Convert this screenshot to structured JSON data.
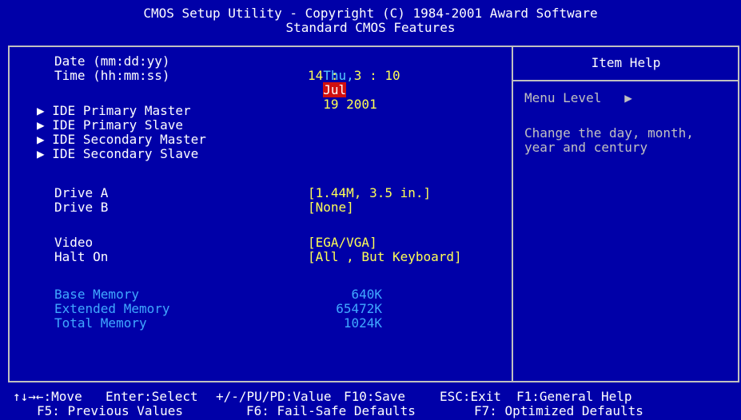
{
  "header": {
    "title": "CMOS Setup Utility - Copyright (C) 1984-2001 Award Software",
    "subtitle": "Standard CMOS Features"
  },
  "date": {
    "label": "Date (mm:dd:yy)",
    "weekday": "Thu,",
    "month": "Jul",
    "rest": "19 2001"
  },
  "time": {
    "label": "Time (hh:mm:ss)",
    "value": "14 :  3 : 10"
  },
  "ide": [
    {
      "marker": "▶",
      "label": "IDE Primary Master"
    },
    {
      "marker": "▶",
      "label": "IDE Primary Slave"
    },
    {
      "marker": "▶",
      "label": "IDE Secondary Master"
    },
    {
      "marker": "▶",
      "label": "IDE Secondary Slave"
    }
  ],
  "drives": {
    "a_label": "Drive A",
    "a_value": "[1.44M, 3.5 in.]",
    "b_label": "Drive B",
    "b_value": "[None]"
  },
  "video": {
    "label": "Video",
    "value": "[EGA/VGA]"
  },
  "halt": {
    "label": "Halt On",
    "value": "[All , But Keyboard]"
  },
  "memory": {
    "base_label": "Base Memory",
    "base_value": "640K",
    "extended_label": "Extended Memory",
    "extended_value": "65472K",
    "total_label": "Total Memory",
    "total_value": "1024K"
  },
  "help_panel": {
    "title": "Item Help",
    "menu_level_label": "Menu Level",
    "menu_level_marker": "▶",
    "description_line1": "Change the day, month,",
    "description_line2": "year and century"
  },
  "footer": {
    "line1_move": "↑↓→←:Move",
    "line1_select": "Enter:Select",
    "line1_value": "+/-/PU/PD:Value",
    "line1_save": "F10:Save",
    "line1_exit": "ESC:Exit",
    "line1_help": "F1:General Help",
    "line2_prev": "F5: Previous Values",
    "line2_failsafe": "F6: Fail-Safe Defaults",
    "line2_optimized": "F7: Optimized Defaults"
  },
  "colors": {
    "background": "#0000a8",
    "value_yellow": "#ffff55",
    "highlight_red": "#d01010",
    "memory_cyan": "#40a8ff"
  }
}
